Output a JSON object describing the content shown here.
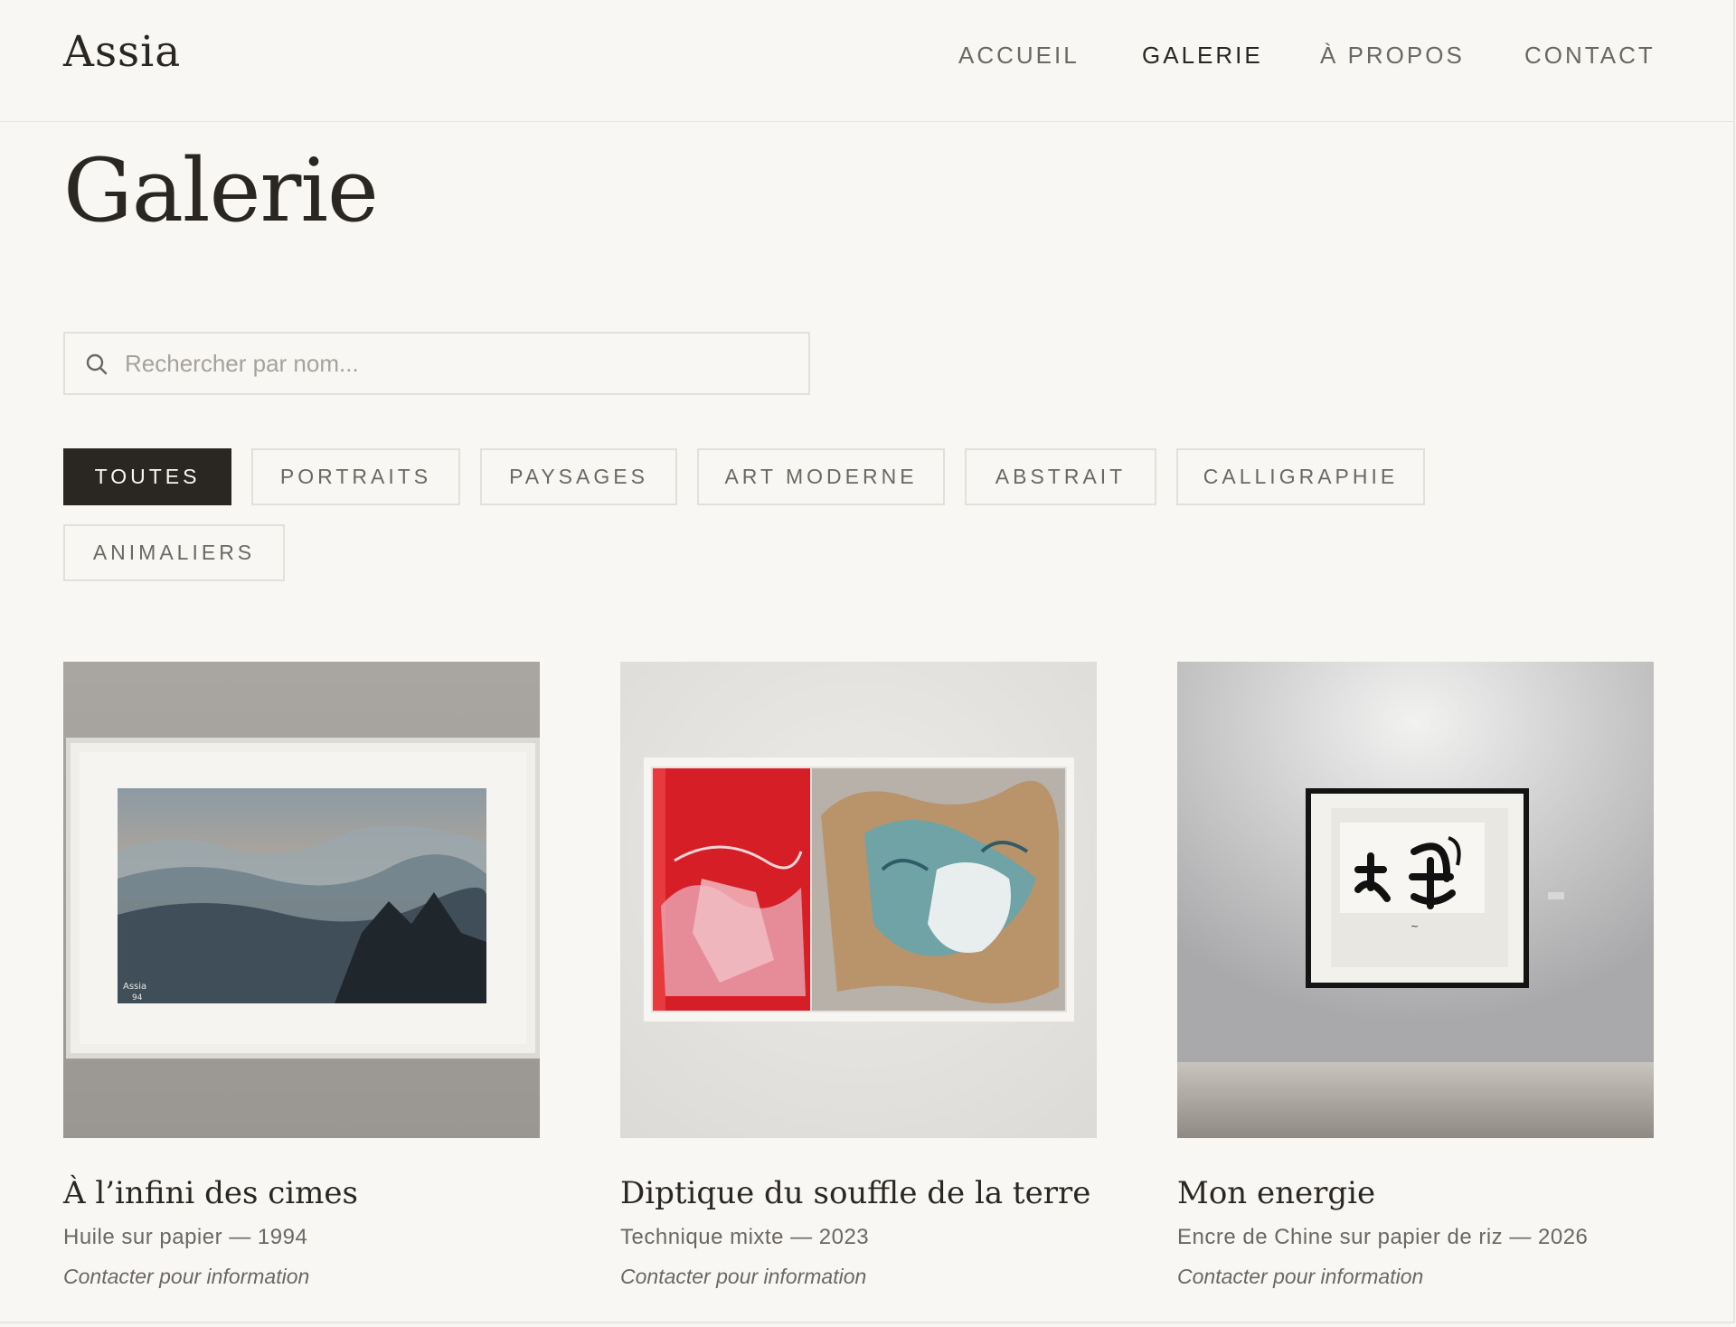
{
  "brand": {
    "logo": "Assia"
  },
  "nav": {
    "items": [
      {
        "label": "ACCUEIL"
      },
      {
        "label": "GALERIE"
      },
      {
        "label": "À PROPOS"
      },
      {
        "label": "CONTACT"
      }
    ],
    "active": "GALERIE"
  },
  "page": {
    "title": "Galerie"
  },
  "search": {
    "placeholder": "Rechercher par nom...",
    "value": ""
  },
  "filters": {
    "items": [
      {
        "label": "TOUTES"
      },
      {
        "label": "PORTRAITS"
      },
      {
        "label": "PAYSAGES"
      },
      {
        "label": "ART MODERNE"
      },
      {
        "label": "ABSTRAIT"
      },
      {
        "label": "CALLIGRAPHIE"
      },
      {
        "label": "ANIMALIERS"
      }
    ],
    "active": "TOUTES"
  },
  "artworks": [
    {
      "title": "À l’infini des cimes",
      "meta": "Huile sur papier — 1994",
      "price": "Contacter pour information",
      "image": "mountain-landscape-painting"
    },
    {
      "title": "Diptique du souffle de la terre",
      "meta": "Technique mixte — 2023",
      "price": "Contacter pour information",
      "image": "abstract-diptych-red-teal"
    },
    {
      "title": "Mon energie",
      "meta": "Encre de Chine sur papier de riz — 2026",
      "price": "Contacter pour information",
      "image": "calligraphy-framed-in-gallery"
    }
  ],
  "colors": {
    "background": "#f8f7f4",
    "text": "#2a2723",
    "muted": "#6b6863",
    "border": "#e3e0db",
    "active_filter": "#2a2723"
  }
}
